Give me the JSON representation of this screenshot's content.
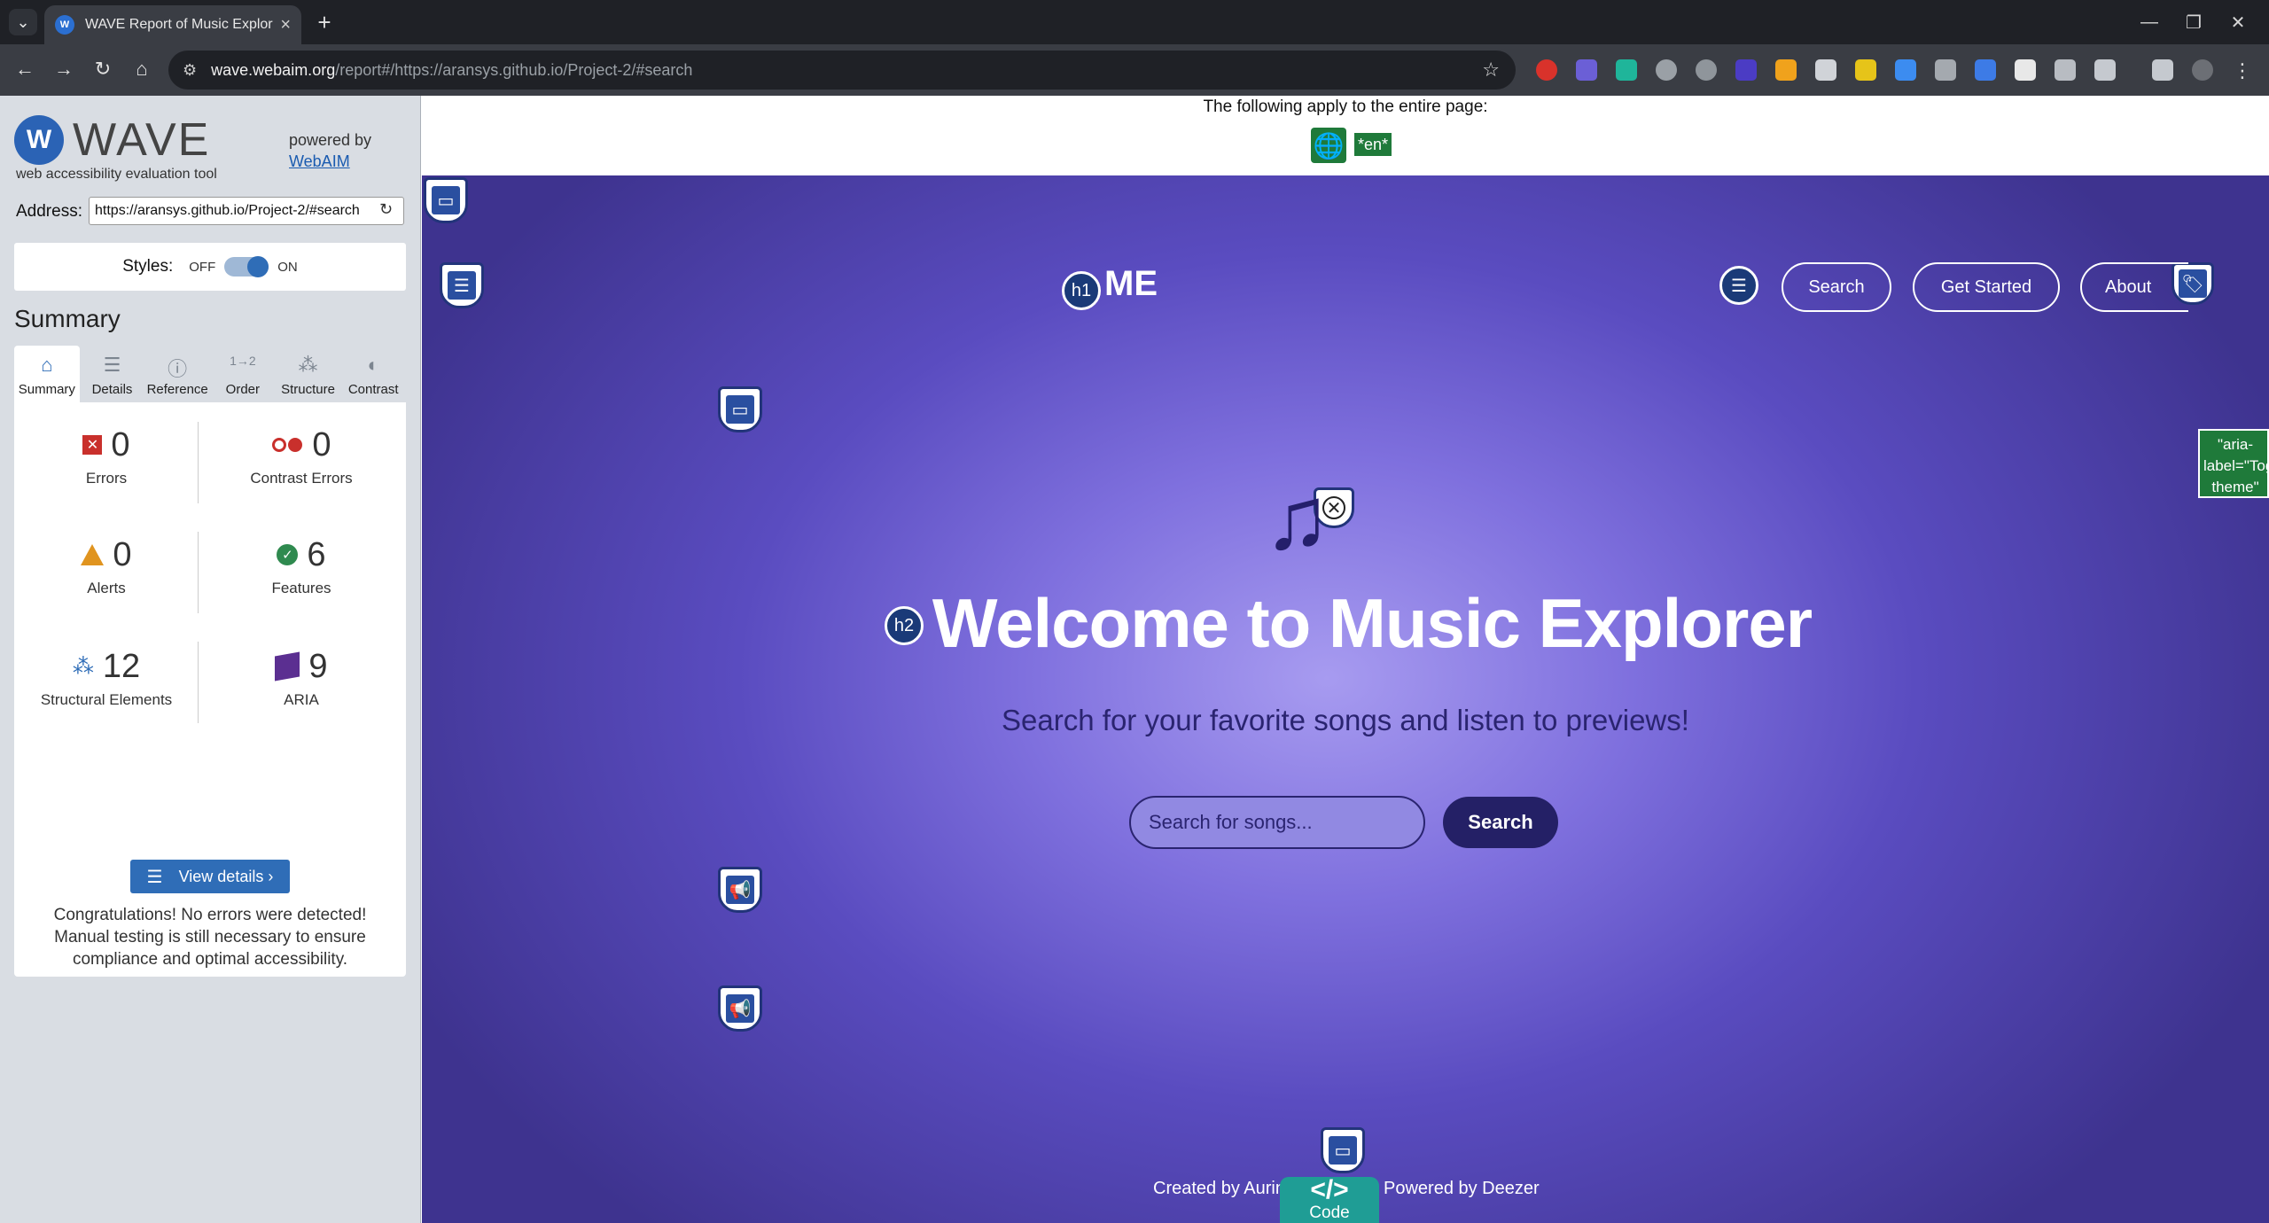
{
  "browser": {
    "tab_title": "WAVE Report of Music Explorer",
    "url_host": "wave.webaim.org",
    "url_path": "/report#/https://aransys.github.io/Project-2/#search"
  },
  "wave": {
    "logo_text": "WAVE",
    "tagline": "web accessibility evaluation tool",
    "powered_by": "powered by",
    "powered_link": "WebAIM",
    "address_label": "Address:",
    "address_value": "https://aransys.github.io/Project-2/#search",
    "styles_label": "Styles:",
    "styles_off": "OFF",
    "styles_on": "ON",
    "summary_heading": "Summary",
    "tabs": [
      {
        "label": "Summary"
      },
      {
        "label": "Details"
      },
      {
        "label": "Reference"
      },
      {
        "label": "Order"
      },
      {
        "label": "Structure"
      },
      {
        "label": "Contrast"
      }
    ],
    "stats": {
      "errors": {
        "count": "0",
        "label": "Errors"
      },
      "contrast": {
        "count": "0",
        "label": "Contrast Errors"
      },
      "alerts": {
        "count": "0",
        "label": "Alerts"
      },
      "features": {
        "count": "6",
        "label": "Features"
      },
      "structural": {
        "count": "12",
        "label": "Structural Elements"
      },
      "aria": {
        "count": "9",
        "label": "ARIA"
      }
    },
    "view_details": "View details ›",
    "congrats": "Congratulations! No errors were detected! Manual testing is still necessary to ensure compliance and optimal accessibility."
  },
  "page_note": {
    "text": "The following apply to the entire page:",
    "lang": "*en*"
  },
  "site": {
    "brand": "ME",
    "h1_badge": "h1",
    "h2_badge": "h2",
    "nav": [
      "Search",
      "Get Started",
      "About"
    ],
    "heading": "Welcome to Music Explorer",
    "subheading": "Search for your favorite songs and listen to previews!",
    "search_placeholder": "Search for songs...",
    "search_button": "Search",
    "aria_label_note": "\"aria-label=\"Toggle theme\"",
    "footer_left": "Created by Aurin",
    "footer_right": "Powered by Deezer"
  },
  "code_toggle": "Code"
}
